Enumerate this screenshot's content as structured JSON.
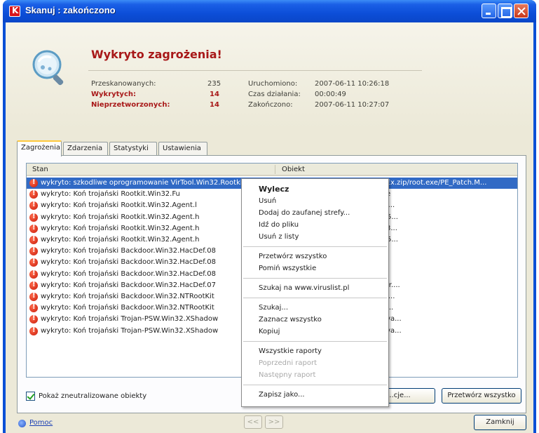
{
  "window": {
    "title": "Skanuj : zakończono"
  },
  "header": {
    "title": "Wykryto zagrożenia!",
    "stats_left": [
      {
        "label": "Przeskanowanych:",
        "value": "235",
        "highlight": false
      },
      {
        "label": "Wykrytych:",
        "value": "14",
        "highlight": true
      },
      {
        "label": "Nieprzetworzonych:",
        "value": "14",
        "highlight": true
      }
    ],
    "stats_right": [
      {
        "label": "Uruchomiono:",
        "value": "2007-06-11 10:26:18"
      },
      {
        "label": "Czas działania:",
        "value": "00:00:49"
      },
      {
        "label": "Zakończono:",
        "value": "2007-06-11 10:27:07"
      }
    ]
  },
  "tabs": [
    {
      "label": "Zagrożenia",
      "active": true
    },
    {
      "label": "Zdarzenia",
      "active": false
    },
    {
      "label": "Statystyki",
      "active": false
    },
    {
      "label": "Ustawienia",
      "active": false
    }
  ],
  "list": {
    "columns": [
      "Stan",
      "Obiekt"
    ],
    "rows": [
      {
        "stan": "wykryto: szkodliwe oprogramowanie VirTool.Win32.Rootkit",
        "obiekt": "...32 Rootkit.zip/Vanquish/PIE_Ex.zip/root.exe/PE_Patch.M...",
        "selected": true
      },
      {
        "stan": "wykryto: Koń trojański Rootkit.Win32.Fu",
        "obiekt": "...tkit.zip/FU_Rootkit/EXE/fu.exe",
        "selected": false
      },
      {
        "stan": "wykryto: Koń trojański Rootkit.Win32.Agent.l",
        "obiekt": "...tkit.zip/FU_Rootkit/EXE/msdir...",
        "selected": false
      },
      {
        "stan": "wykryto: Koń trojański Rootkit.Win32.Agent.h",
        "obiekt": "...k215b6.zip/He4HookInv/Dev5...",
        "selected": false
      },
      {
        "stan": "wykryto: Koń trojański Rootkit.Win32.Agent.h",
        "obiekt": "...k215b6.zip/He4HookInv/Win3...",
        "selected": false
      },
      {
        "stan": "wykryto: Koń trojański Rootkit.Win32.Agent.h",
        "obiekt": "...k215b6.zip/He4HookInv/Dev5...",
        "selected": false
      },
      {
        "stan": "wykryto: Koń trojański Backdoor.Win32.HacDef.08",
        "obiekt": "...00.zip/hxdef100.exe",
        "selected": false
      },
      {
        "stan": "wykryto: Koń trojański Backdoor.Win32.HacDef.08",
        "obiekt": "...00.zip/rdrbs100.exe",
        "selected": false
      },
      {
        "stan": "wykryto: Koń trojański Backdoor.Win32.HacDef.08",
        "obiekt": "...00.zip/bdcli100.exe",
        "selected": false
      },
      {
        "stan": "wykryto: Koń trojański Backdoor.Win32.HacDef.07",
        "obiekt": "...00.zip/src.zip/src/driver/driver....",
        "selected": false
      },
      {
        "stan": "wykryto: Koń trojański Backdoor.Win32.NTRootKit",
        "obiekt": "...tkit.rar/NT4.0-Rootkit/deploy....",
        "selected": false
      },
      {
        "stan": "wykryto: Koń trojański Backdoor.Win32.NTRootKit",
        "obiekt": "...tkit.rar/NT4.0-Rootkit/_root_....",
        "selected": false
      },
      {
        "stan": "wykryto: Koń trojański Trojan-PSW.Win32.XShadow",
        "obiekt": "...sh20.rar/Vanquish 0.2.0/bin/va...",
        "selected": false
      },
      {
        "stan": "wykryto: Koń trojański Trojan-PSW.Win32.XShadow",
        "obiekt": "...sh20.rar/Vanquish 0.2.0/bin/va...",
        "selected": false
      }
    ]
  },
  "panel_footer": {
    "checkbox_label": "Pokaż zneutralizowane obiekty",
    "checkbox_checked": true,
    "btn_actions": "...cje...",
    "btn_process_all": "Przetwórz wszystko"
  },
  "context_menu": {
    "items": [
      {
        "label": "Wylecz",
        "bold": true,
        "disabled": false
      },
      {
        "label": "Usuń",
        "bold": false,
        "disabled": false
      },
      {
        "label": "Dodaj do zaufanej strefy...",
        "bold": false,
        "disabled": false
      },
      {
        "label": "Idź do pliku",
        "bold": false,
        "disabled": false
      },
      {
        "label": "Usuń z listy",
        "bold": false,
        "disabled": false
      },
      {
        "separator": true
      },
      {
        "label": "Przetwórz wszystko",
        "bold": false,
        "disabled": false
      },
      {
        "label": "Pomiń wszystkie",
        "bold": false,
        "disabled": false
      },
      {
        "separator": true
      },
      {
        "label": "Szukaj na www.viruslist.pl",
        "bold": false,
        "disabled": false
      },
      {
        "separator": true
      },
      {
        "label": "Szukaj...",
        "bold": false,
        "disabled": false
      },
      {
        "label": "Zaznacz wszystko",
        "bold": false,
        "disabled": false
      },
      {
        "label": "Kopiuj",
        "bold": false,
        "disabled": false
      },
      {
        "separator": true
      },
      {
        "label": "Wszystkie raporty",
        "bold": false,
        "disabled": false
      },
      {
        "label": "Poprzedni raport",
        "bold": false,
        "disabled": true
      },
      {
        "label": "Następny raport",
        "bold": false,
        "disabled": true
      },
      {
        "separator": true
      },
      {
        "label": "Zapisz jako...",
        "bold": false,
        "disabled": false
      }
    ]
  },
  "footer": {
    "help_label": "Pomoc",
    "prev_label": "<<",
    "next_label": ">>",
    "close_label": "Zamknij"
  },
  "colors": {
    "threat_red": "#a81818",
    "selection": "#316ac5",
    "titlebar": "#0a50d6"
  }
}
